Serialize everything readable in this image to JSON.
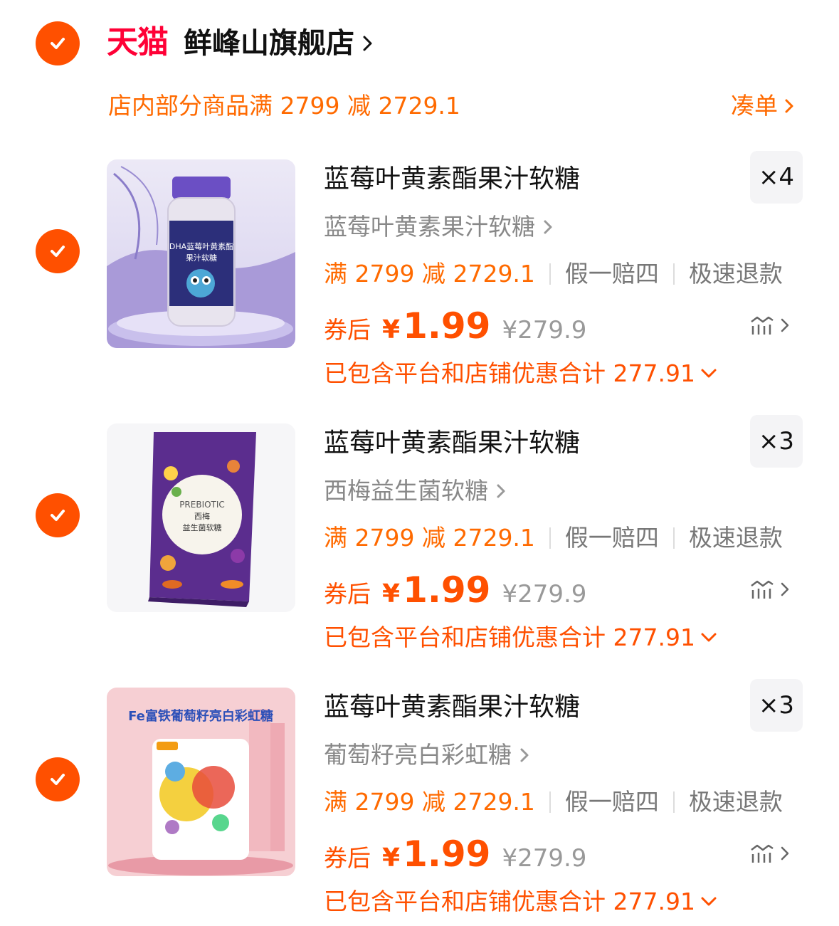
{
  "colors": {
    "accent": "#ff5000",
    "promo": "#ff6a00",
    "tmall": "#ff0036"
  },
  "shop": {
    "logo_text": "天猫",
    "name": "鲜峰山旗舰店",
    "promo": "店内部分商品满 2799 减 2729.1",
    "promo_link": "凑单"
  },
  "items": [
    {
      "title": "蓝莓叶黄素酯果汁软糖",
      "quantity": "×4",
      "sku": "蓝莓叶黄素果汁软糖",
      "promo_tag": "满 2799 减 2729.1",
      "tag_fake": "假一赔四",
      "tag_refund": "极速退款",
      "price_label": "券后",
      "currency": "¥",
      "price": "1.99",
      "original_price": "¥279.9",
      "discount_note": "已包含平台和店铺优惠合计 277.91",
      "image_icon": "gummy-bottle-icon"
    },
    {
      "title": "蓝莓叶黄素酯果汁软糖",
      "quantity": "×3",
      "sku": "西梅益生菌软糖",
      "promo_tag": "满 2799 减 2729.1",
      "tag_fake": "假一赔四",
      "tag_refund": "极速退款",
      "price_label": "券后",
      "currency": "¥",
      "price": "1.99",
      "original_price": "¥279.9",
      "discount_note": "已包含平台和店铺优惠合计 277.91",
      "image_icon": "prebiotic-box-icon"
    },
    {
      "title": "蓝莓叶黄素酯果汁软糖",
      "quantity": "×3",
      "sku": "葡萄籽亮白彩虹糖",
      "promo_tag": "满 2799 减 2729.1",
      "tag_fake": "假一赔四",
      "tag_refund": "极速退款",
      "price_label": "券后",
      "currency": "¥",
      "price": "1.99",
      "original_price": "¥279.9",
      "discount_note": "已包含平台和店铺优惠合计 277.91",
      "image_icon": "candy-pouch-icon"
    }
  ],
  "images": {
    "item0": {
      "label_line1": "DHA蓝莓叶黄素酯",
      "label_line2": "果汁软糖"
    },
    "item1": {
      "label_line1": "PREBIOTIC",
      "label_line2": "西梅",
      "label_line3": "益生菌软糖"
    },
    "item2": {
      "banner": "Fe富铁葡萄籽亮白彩虹糖"
    }
  }
}
